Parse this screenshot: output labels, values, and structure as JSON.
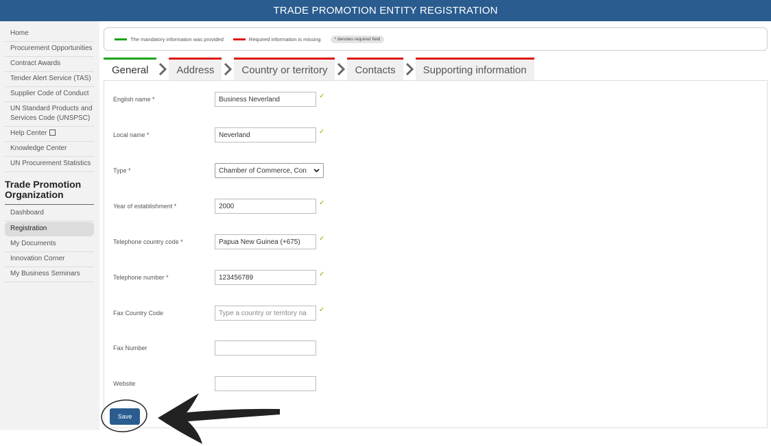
{
  "header": {
    "title": "TRADE PROMOTION ENTITY REGISTRATION"
  },
  "sidebar": {
    "items": [
      {
        "label": "Home"
      },
      {
        "label": "Procurement Opportunities"
      },
      {
        "label": "Contract Awards"
      },
      {
        "label": "Tender Alert Service (TAS)"
      },
      {
        "label": "Supplier Code of Conduct"
      },
      {
        "label": "UN Standard Products and Services Code (UNSPSC)"
      },
      {
        "label": "Help Center"
      },
      {
        "label": "Knowledge Center"
      },
      {
        "label": "UN Procurement Statistics"
      }
    ],
    "section_heading": "Trade Promotion Organization",
    "section_items": [
      {
        "label": "Dashboard"
      },
      {
        "label": "Registration",
        "active": true
      },
      {
        "label": "My Documents"
      },
      {
        "label": "Innovation Corner"
      },
      {
        "label": "My Business Seminars"
      }
    ]
  },
  "legend": {
    "provided": "The mandatory information was provided",
    "missing": "Required information is missing",
    "required_note": "* denotes required field",
    "colors": {
      "provided": "#19a319",
      "missing": "#e01515"
    }
  },
  "tabs": [
    {
      "label": "General",
      "status": "complete"
    },
    {
      "label": "Address",
      "status": "missing"
    },
    {
      "label": "Country or territory",
      "status": "missing"
    },
    {
      "label": "Contacts",
      "status": "missing"
    },
    {
      "label": "Supporting information",
      "status": "missing"
    }
  ],
  "form": {
    "english_name": {
      "label": "English name *",
      "value": "Business Neverland",
      "valid": "✓"
    },
    "local_name": {
      "label": "Local name *",
      "value": "Neverland",
      "valid": "✓"
    },
    "type": {
      "label": "Type *",
      "value": "Chamber of Commerce, Con"
    },
    "year": {
      "label": "Year of establishment *",
      "value": "2000",
      "valid": "✓"
    },
    "tel_code": {
      "label": "Telephone country code *",
      "value": "Papua New Guinea (+675)",
      "valid": "✓"
    },
    "tel_number": {
      "label": "Telephone number *",
      "value": "123456789",
      "valid": "✓"
    },
    "fax_code": {
      "label": "Fax Country Code",
      "placeholder": "Type a country or territory na",
      "valid": "✓"
    },
    "fax_number": {
      "label": "Fax Number",
      "value": ""
    },
    "website": {
      "label": "Website",
      "value": ""
    }
  },
  "actions": {
    "save_label": "Save"
  },
  "theme": {
    "primary": "#2a5c8f",
    "check": "#7cb800"
  }
}
